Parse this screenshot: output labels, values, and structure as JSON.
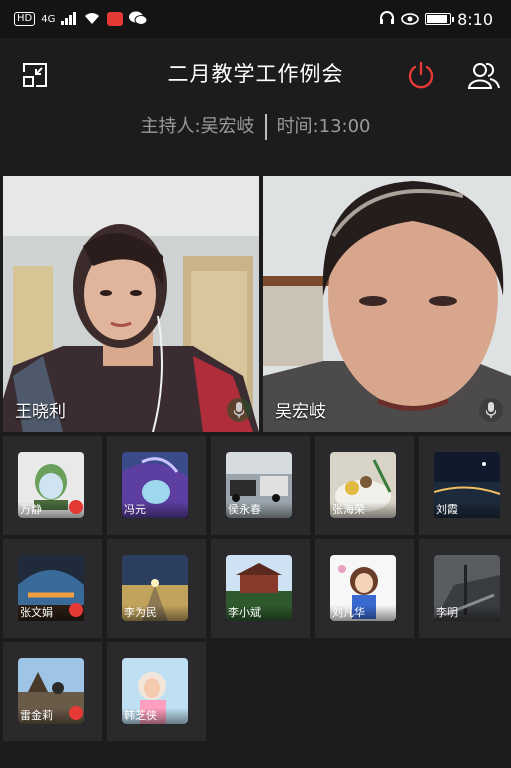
{
  "status_bar": {
    "hd": "HD",
    "net": "4G",
    "time": "8:10",
    "battery_level": 0.85
  },
  "meeting": {
    "title": "二月教学工作例会",
    "host_label": "主持人:",
    "host_name": "吴宏岐",
    "time_label": "时间:",
    "time": "13:00"
  },
  "videos": [
    {
      "name": "王晓利"
    },
    {
      "name": "吴宏岐"
    }
  ],
  "participants": [
    {
      "name": "万静",
      "flag": true
    },
    {
      "name": "冯元",
      "flag": false
    },
    {
      "name": "侯永春",
      "flag": false
    },
    {
      "name": "张海荣",
      "flag": false
    },
    {
      "name": "刘霞",
      "flag": false
    },
    {
      "name": "张文娟",
      "flag": true
    },
    {
      "name": "李为民",
      "flag": false
    },
    {
      "name": "李小斌",
      "flag": false
    },
    {
      "name": "刘凡华",
      "flag": false
    },
    {
      "name": "李明",
      "flag": false
    },
    {
      "name": "雷金莉",
      "flag": true
    },
    {
      "name": "韩芝侠",
      "flag": false
    }
  ],
  "colors": {
    "accent_power": "#e53935",
    "background": "#1c1c1e",
    "tile": "#2a2a2c"
  }
}
